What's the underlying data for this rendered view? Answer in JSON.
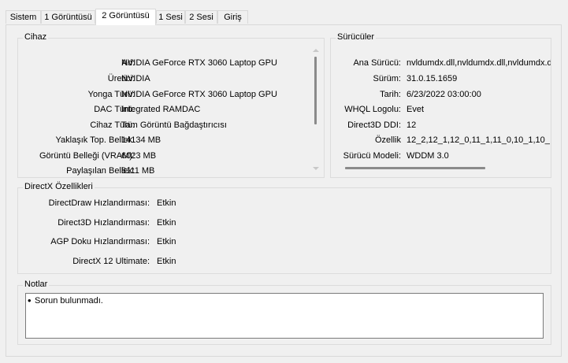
{
  "tabs": [
    {
      "label": "Sistem"
    },
    {
      "label": "1 Görüntüsü"
    },
    {
      "label": "2 Görüntüsü"
    },
    {
      "label": "1 Sesi"
    },
    {
      "label": "2 Sesi"
    },
    {
      "label": "Giriş"
    }
  ],
  "device": {
    "title": "Cihaz",
    "rows": [
      {
        "label": "Ad:",
        "value": "NVIDIA GeForce RTX 3060 Laptop GPU"
      },
      {
        "label": "Üretici:",
        "value": "NVIDIA"
      },
      {
        "label": "Yonga Türü:",
        "value": "NVIDIA GeForce RTX 3060 Laptop GPU"
      },
      {
        "label": "DAC Türü:",
        "value": "Integrated RAMDAC"
      },
      {
        "label": "Cihaz Türü:",
        "value": "Tam Görüntü Bağdaştırıcısı"
      },
      {
        "label": "Yaklaşık Top. Bellek:",
        "value": "14134 MB"
      },
      {
        "label": "Görüntü Belleği (VRAM):",
        "value": "6023 MB"
      },
      {
        "label": "Paylaşılan Bellek:",
        "value": "8111 MB"
      }
    ]
  },
  "drivers": {
    "title": "Sürücüler",
    "rows": [
      {
        "label": "Ana Sürücü:",
        "value": "nvldumdx.dll,nvldumdx.dll,nvldumdx.d"
      },
      {
        "label": "Sürüm:",
        "value": "31.0.15.1659"
      },
      {
        "label": "Tarih:",
        "value": "6/23/2022 03:00:00"
      },
      {
        "label": "WHQL Logolu:",
        "value": "Evet"
      },
      {
        "label": "Direct3D DDI:",
        "value": "12"
      },
      {
        "label": "Özellik",
        "value": "12_2,12_1,12_0,11_1,11_0,10_1,10_"
      },
      {
        "label": "Sürücü Modeli:",
        "value": "WDDM 3.0"
      }
    ]
  },
  "directx": {
    "title": "DirectX Özellikleri",
    "rows": [
      {
        "label": "DirectDraw Hızlandırması:",
        "value": "Etkin"
      },
      {
        "label": "Direct3D Hızlandırması:",
        "value": "Etkin"
      },
      {
        "label": "AGP Doku Hızlandırması:",
        "value": "Etkin"
      },
      {
        "label": "DirectX 12 Ultimate:",
        "value": "Etkin"
      }
    ]
  },
  "notes": {
    "title": "Notlar",
    "items": [
      "Sorun bulunmadı."
    ]
  }
}
